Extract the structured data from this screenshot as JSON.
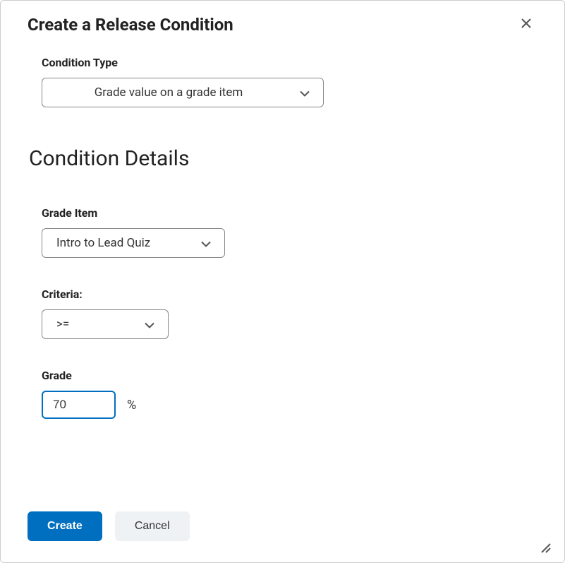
{
  "dialog": {
    "title": "Create a Release Condition"
  },
  "conditionType": {
    "label": "Condition Type",
    "value": "Grade value on a grade item"
  },
  "sectionHeading": "Condition Details",
  "gradeItem": {
    "label": "Grade Item",
    "value": "Intro to Lead Quiz"
  },
  "criteria": {
    "label": "Criteria:",
    "value": ">="
  },
  "grade": {
    "label": "Grade",
    "value": "70",
    "unit": "%"
  },
  "buttons": {
    "create": "Create",
    "cancel": "Cancel"
  }
}
